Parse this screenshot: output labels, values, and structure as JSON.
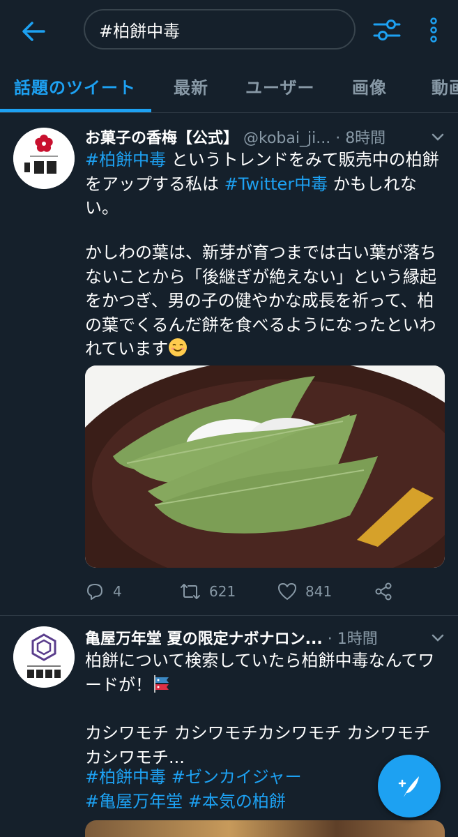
{
  "search": {
    "query": "#柏餅中毒"
  },
  "tabs": [
    {
      "label": "話題のツイート"
    },
    {
      "label": "最新"
    },
    {
      "label": "ユーザー"
    },
    {
      "label": "画像"
    },
    {
      "label": "動画"
    }
  ],
  "tweets": [
    {
      "name": "お菓子の香梅【公式】",
      "handle": "@kobai_ji...",
      "time": "· 8時間",
      "body": {
        "p1_tag1": "#柏餅中毒",
        "p1_text1": " というトレンドをみて販売中の柏餅をアップする私は ",
        "p1_tag2": "#Twitter中毒",
        "p1_text2": " かもしれない。",
        "p2": "かしわの葉は、新芽が育つまでは古い葉が落ちないことから「後継ぎが絶えない」という縁起をかつぎ、男の子の健やかな成長を祈って、柏の葉でくるんだ餅を食べるようになったといわれています"
      },
      "reply_count": "4",
      "retweet_count": "621",
      "like_count": "841"
    },
    {
      "name": "亀屋万年堂 夏の限定ナボナロン...",
      "time": "· 1時間",
      "body": {
        "line1": "柏餅について検索していたら柏餅中毒なんてワードが！",
        "line2": "カシワモチ カシワモチカシワモチ カシワモチ カシワモチ...",
        "tag1": "#柏餅中毒",
        "tag2": "#ゼンカイジャー",
        "tag3": "#亀屋万年堂",
        "tag4": "#本気の柏餅"
      }
    }
  ],
  "colors": {
    "background": "#15202b",
    "accent": "#1da1f2",
    "secondary_text": "#8899a6",
    "divider": "#2f3b46"
  },
  "icons": {
    "back": "arrow-left-icon",
    "filter": "sliders-icon",
    "more": "more-vertical-icon",
    "chevron": "chevron-down-icon",
    "reply": "reply-icon",
    "retweet": "retweet-icon",
    "like": "heart-icon",
    "share": "share-icon",
    "compose": "compose-icon"
  }
}
